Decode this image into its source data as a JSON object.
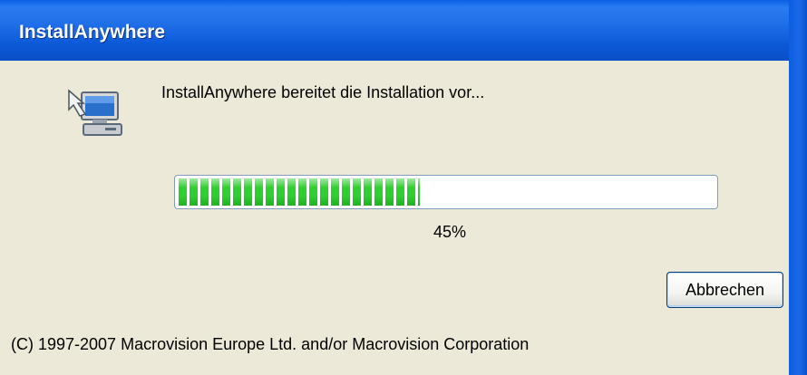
{
  "window": {
    "title": "InstallAnywhere"
  },
  "main": {
    "icon": "computer-install-icon",
    "message": "InstallAnywhere bereitet die Installation vor...",
    "progress_fraction": 0.45,
    "progress_text": "45%",
    "progress_color": "#2fcf2f"
  },
  "buttons": {
    "cancel_label": "Abbrechen"
  },
  "footer": {
    "copyright": "(C) 1997-2007 Macrovision Europe Ltd. and/or Macrovision Corporation"
  },
  "colors": {
    "titlebar": "#0a5fe3",
    "background": "#ece9d8"
  }
}
